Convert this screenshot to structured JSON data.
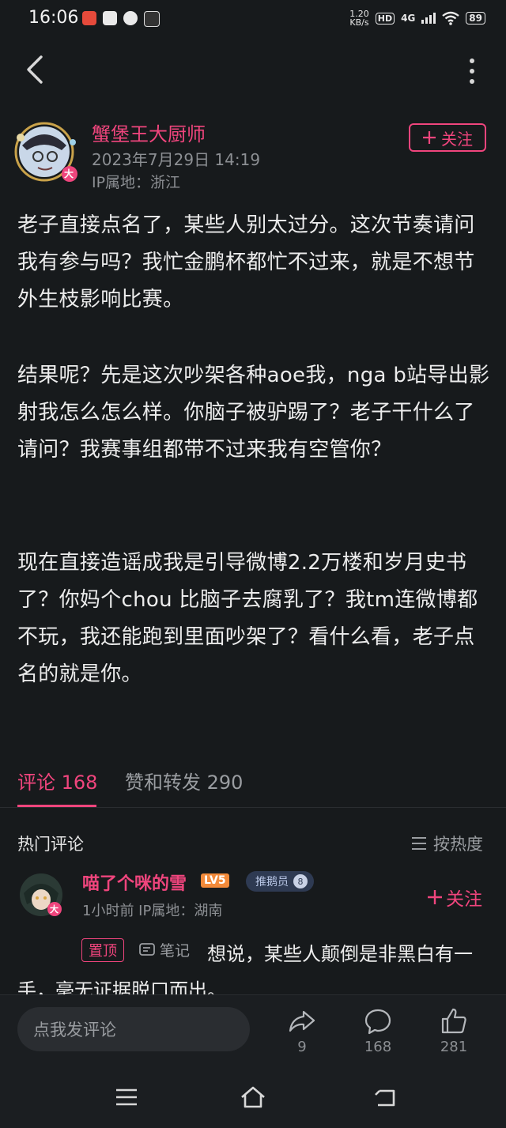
{
  "status_bar": {
    "time": "16:06",
    "net_speed_value": "1.20",
    "net_speed_unit": "KB/s",
    "hd": "HD",
    "network": "4G",
    "battery": "89"
  },
  "post": {
    "author": "蟹堡王大厨师",
    "avatar_badge": "大",
    "date": "2023年7月29日 14:19",
    "ip": "IP属地：浙江",
    "follow_label": "关注",
    "paragraphs": [
      "老子直接点名了，某些人别太过分。这次节奏请问我有参与吗？我忙金鹏杯都忙不过来，就是不想节外生枝影响比赛。",
      "结果呢？先是这次吵架各种aoe我，nga b站导出影射我怎么怎么样。你脑子被驴踢了？老子干什么了请问？我赛事组都带不过来我有空管你？",
      "现在直接造谣成我是引导微博2.2万楼和岁月史书了？你妈个chou 比脑子去腐乳了？我tm连微博都不玩，我还能跑到里面吵架了？看什么看，老子点名的就是你。"
    ]
  },
  "tabs": {
    "comments": "评论 168",
    "likes_reposts": "赞和转发 290"
  },
  "hot_comments": {
    "title": "热门评论",
    "sort_label": "按热度"
  },
  "comment": {
    "user": "喵了个咪的雪",
    "level": "LV5",
    "role": "推鹅员",
    "role_num": "8",
    "avatar_badge": "大",
    "meta": "1小时前  IP属地：湖南",
    "follow_label": "关注",
    "pin": "置顶",
    "note": "笔记",
    "text": "想说，某些人颠倒是非黑白有一手，毫无证据脱口而出。"
  },
  "bottom_bar": {
    "input_placeholder": "点我发评论",
    "share_count": "9",
    "comment_count": "168",
    "like_count": "281"
  },
  "colors": {
    "accent": "#f0457d",
    "background": "#171a1c"
  }
}
